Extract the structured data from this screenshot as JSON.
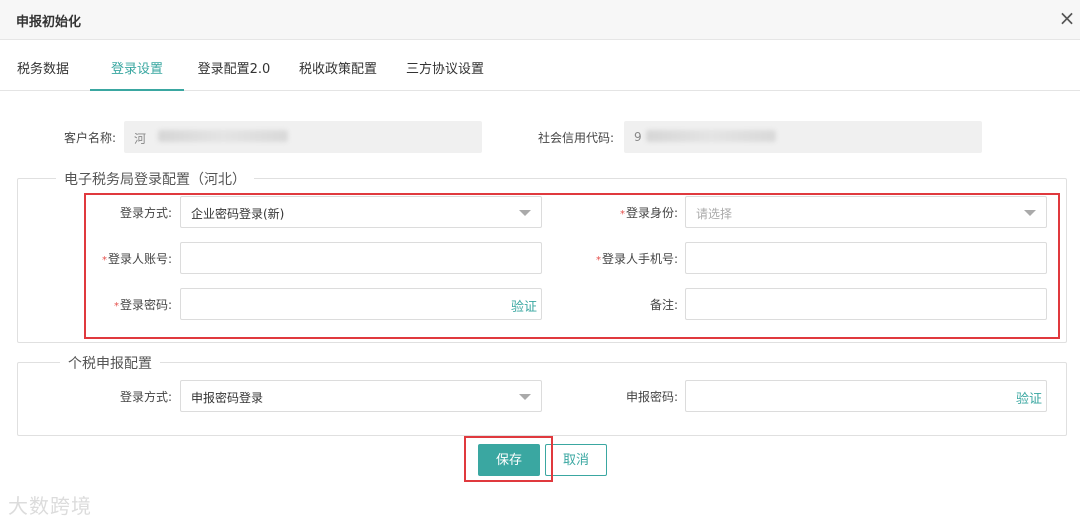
{
  "dialog": {
    "title": "申报初始化",
    "close_icon": "×"
  },
  "tabs": [
    {
      "label": "税务数据",
      "active": false
    },
    {
      "label": "登录设置",
      "active": true
    },
    {
      "label": "登录配置2.0",
      "active": false
    },
    {
      "label": "税收政策配置",
      "active": false
    },
    {
      "label": "三方协议设置",
      "active": false
    }
  ],
  "customer": {
    "name_label": "客户名称:",
    "name_value_visible": "河",
    "credit_label": "社会信用代码:",
    "credit_value_visible": "9"
  },
  "etax": {
    "legend": "电子税务局登录配置（河北）",
    "login_method_label": "登录方式:",
    "login_method_value": "企业密码登录(新)",
    "identity_label": "登录身份:",
    "identity_placeholder": "请选择",
    "account_label": "登录人账号:",
    "phone_label": "登录人手机号:",
    "password_label": "登录密码:",
    "verify_label": "验证",
    "remark_label": "备注:",
    "required_mark": "*"
  },
  "iit": {
    "legend": "个税申报配置",
    "login_method_label": "登录方式:",
    "login_method_value": "申报密码登录",
    "password_label": "申报密码:",
    "verify_label": "验证"
  },
  "actions": {
    "save_label": "保存",
    "cancel_label": "取消"
  },
  "watermark": "大数跨境",
  "colors": {
    "accent": "#3aa7a1",
    "required": "#e5504c",
    "highlight": "#e0393e"
  }
}
